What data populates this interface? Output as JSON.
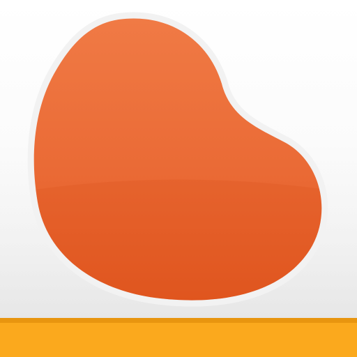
{
  "icon": {
    "name": "bean-icon",
    "colors": {
      "background_top": "#ffffff",
      "background_bottom": "#ececec",
      "bean_light": "#f07a45",
      "bean_mid": "#ea6a35",
      "bean_dark": "#e0541d",
      "bean_outline": "#f2f2f2",
      "band_edge": "#e8950f",
      "band_fill": "#fba91d"
    }
  }
}
